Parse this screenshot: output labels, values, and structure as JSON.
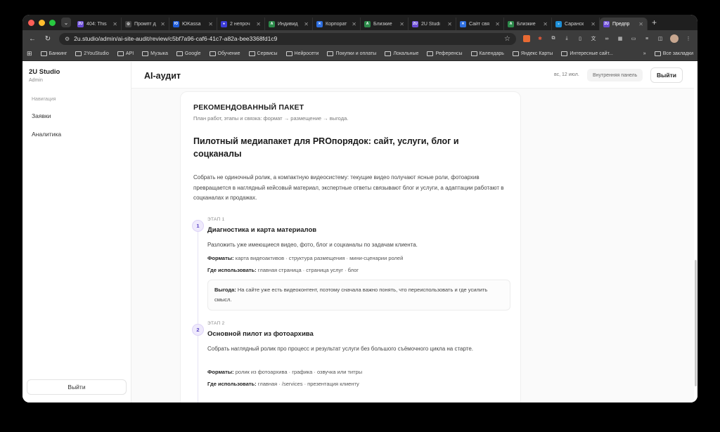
{
  "browser": {
    "tabs": [
      {
        "favicon": "2U",
        "color": "#6b4cd6",
        "title": "404: This"
      },
      {
        "favicon": "◎",
        "color": "#444444",
        "title": "Промпт д"
      },
      {
        "favicon": "Ю",
        "color": "#1e5bd8",
        "title": "ЮKassa"
      },
      {
        "favicon": "●",
        "color": "#3c3cd8",
        "title": "2 непроч"
      },
      {
        "favicon": "A",
        "color": "#2c8a4a",
        "title": "Индивид"
      },
      {
        "favicon": "✕",
        "color": "#2e6fe0",
        "title": "Корпорат"
      },
      {
        "favicon": "A",
        "color": "#2c8a4a",
        "title": "Близкие"
      },
      {
        "favicon": "2U",
        "color": "#6b4cd6",
        "title": "2U Studi"
      },
      {
        "favicon": "✕",
        "color": "#2e6fe0",
        "title": "Сайт свя"
      },
      {
        "favicon": "A",
        "color": "#2c8a4a",
        "title": "Близкие"
      },
      {
        "favicon": "◒",
        "color": "#1d8fd8",
        "title": "Саранск"
      },
      {
        "favicon": "2U",
        "color": "#6b4cd6",
        "title": "Предпр",
        "active": true
      }
    ],
    "url": "2u.studio/admin/ai-site-audit/review/c5bf7a96-caf6-41c7-a82a-bee3368fd1c9",
    "bookmarks": [
      "Банкинг",
      "2YouStudio",
      "API",
      "Музыка",
      "Google",
      "Обучение",
      "Сервисы",
      "Нейросети",
      "Покупки и оплаты",
      "Локальные",
      "Референсы",
      "Календарь",
      "Яндекс Карты",
      "Интересные сайт..."
    ],
    "all_bookmarks": "Все закладки"
  },
  "sidebar": {
    "brand": "2U Studio",
    "role": "Admin",
    "section": "Навигация",
    "items": [
      "Заявки",
      "Аналитика"
    ],
    "logout": "Выйти"
  },
  "header": {
    "title": "AI-аудит",
    "date": "вс, 12 июл.",
    "panel": "Внутренняя панель",
    "logout": "Выйти"
  },
  "card": {
    "title": "РЕКОМЕНДОВАННЫЙ ПАКЕТ",
    "subtitle": "План работ, этапы и связка: формат → размещение → выгода.",
    "package_title": "Пилотный медиапакет для PROпорядок: сайт, услуги, блог и соцканалы",
    "package_desc": "Собрать не одиночный ролик, а компактную видеосистему: текущие видео получают ясные роли, фотоархив превращается в наглядный кейсовый материал, экспертные ответы связывают блог и услуги, а адаптации работают в соцканалах и продажах.",
    "stages": [
      {
        "num": "1",
        "label": "ЭТАП 1",
        "title": "Диагностика и карта материалов",
        "desc": "Разложить уже имеющиеся видео, фото, блог и соцканалы по задачам клиента.",
        "formats_label": "Форматы:",
        "formats": "карта видеоактивов · структура размещения · мини-сценарии ролей",
        "where_label": "Где использовать:",
        "where": "главная страница · страница услуг · блог",
        "benefit_label": "Выгода:",
        "benefit": "На сайте уже есть видеоконтент, поэтому сначала важно понять, что переиспользовать и где усилить смысл."
      },
      {
        "num": "2",
        "label": "ЭТАП 2",
        "title": "Основной пилот из фотоархива",
        "desc": "Собрать наглядный ролик про процесс и результат услуги без большого съёмочного цикла на старте.",
        "formats_label": "Форматы:",
        "formats": "ролик из фотоархива · графика · озвучка или титры",
        "where_label": "Где использовать:",
        "where": "главная · /services · презентация клиенту"
      }
    ]
  }
}
